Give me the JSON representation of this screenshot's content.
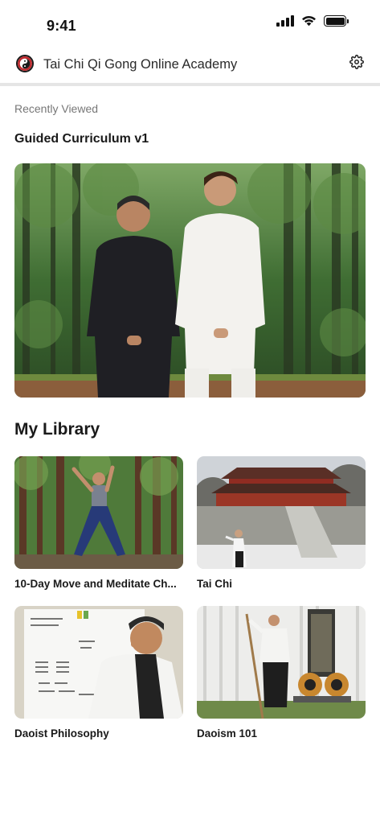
{
  "status_bar": {
    "time": "9:41",
    "icons": [
      "signal-icon",
      "wifi-icon",
      "battery-icon"
    ]
  },
  "header": {
    "logo_icon": "yin-yang-logo-icon",
    "title": "Tai Chi Qi Gong Online Academy",
    "settings_icon": "gear-icon"
  },
  "recently_viewed": {
    "label": "Recently Viewed",
    "item_title": "Guided Curriculum v1"
  },
  "library": {
    "title": "My Library",
    "items": [
      {
        "label": "10-Day Move and Meditate Ch..."
      },
      {
        "label": "Tai Chi"
      },
      {
        "label": "Daoist Philosophy"
      },
      {
        "label": "Daoism 101"
      }
    ]
  },
  "colors": {
    "accent_text": "#1a1a1a",
    "muted_text": "#777777",
    "divider": "#e5e5e5",
    "logo_red": "#c0282d"
  }
}
